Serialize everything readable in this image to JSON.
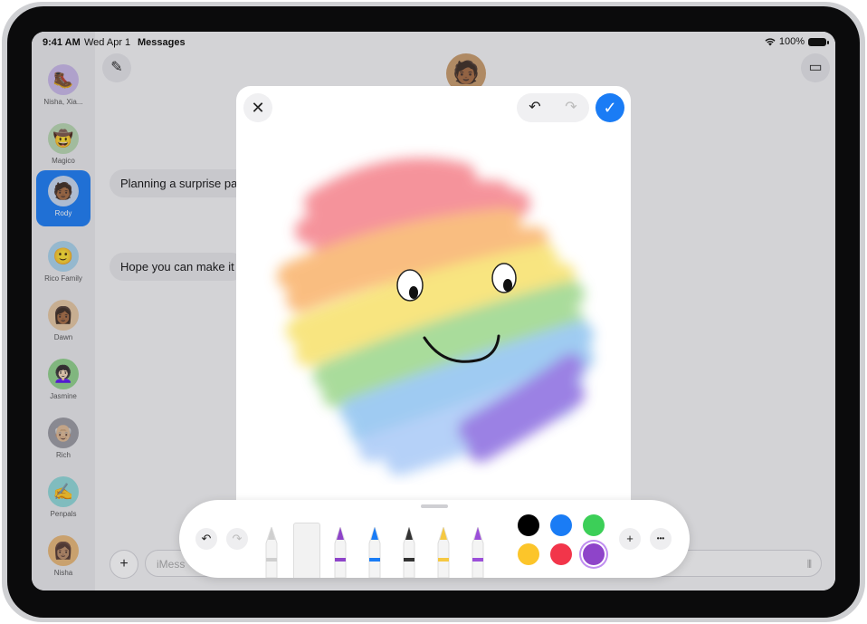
{
  "status": {
    "time": "9:41 AM",
    "date": "Wed Apr 1",
    "app": "Messages",
    "battery": "100%"
  },
  "sidebar": {
    "contacts": [
      {
        "name": "Nisha, Xia...",
        "emoji": "🥾",
        "color": "#c8b8e8"
      },
      {
        "name": "Magico",
        "emoji": "🤠",
        "color": "#b7d7b0"
      },
      {
        "name": "Rody",
        "emoji": "🧑🏾",
        "color": "#c7d8f0",
        "active": true
      },
      {
        "name": "Rico Family",
        "emoji": "🙂",
        "color": "#a9d3ec"
      },
      {
        "name": "Dawn",
        "emoji": "👩🏾",
        "color": "#e6c7a1"
      },
      {
        "name": "Jasmine",
        "emoji": "👩🏻‍🦱",
        "color": "#8fd18a"
      },
      {
        "name": "Rich",
        "emoji": "👴🏼",
        "color": "#9a9aa2"
      },
      {
        "name": "Penpals",
        "emoji": "✍️",
        "color": "#8fd8d8"
      },
      {
        "name": "Nisha",
        "emoji": "👩🏽",
        "color": "#e8b877"
      }
    ]
  },
  "chat": {
    "messages": [
      {
        "text": "Planning a surprise par"
      },
      {
        "text": "Hope you can make it"
      }
    ],
    "input_placeholder": "iMess",
    "avatar_emoji": "🧑🏾"
  },
  "icons": {
    "compose": "✎",
    "video": "▭",
    "plus": "+",
    "close": "✕",
    "undo": "↶",
    "redo": "↷",
    "done": "✓",
    "more": "•••",
    "mic": "⦀"
  },
  "drawing": {
    "bands": [
      {
        "color": "#f4818a"
      },
      {
        "color": "#f9b26a"
      },
      {
        "color": "#f7e16a"
      },
      {
        "color": "#9bd68a"
      },
      {
        "color": "#8fc3f0"
      },
      {
        "color": "#a9c9f7"
      },
      {
        "color": "#8a6ce0"
      }
    ]
  },
  "toolbar": {
    "tools": [
      {
        "name": "pencil-tool",
        "tip": "#cfcfcf"
      },
      {
        "name": "ruler-tool",
        "tip": "#e0e0e0"
      },
      {
        "name": "pencil-purple",
        "tip": "#8e44c9"
      },
      {
        "name": "marker-blue",
        "tip": "#1a7cf5"
      },
      {
        "name": "fountain-pen",
        "tip": "#333333"
      },
      {
        "name": "highlighter-yellow",
        "tip": "#f5c842"
      },
      {
        "name": "brush-purple",
        "tip": "#9b4fd9"
      }
    ],
    "colors": [
      "#000000",
      "#1a7cf5",
      "#3ccf58",
      "#fcc52a",
      "#f2354a",
      "#8e44c9"
    ]
  }
}
